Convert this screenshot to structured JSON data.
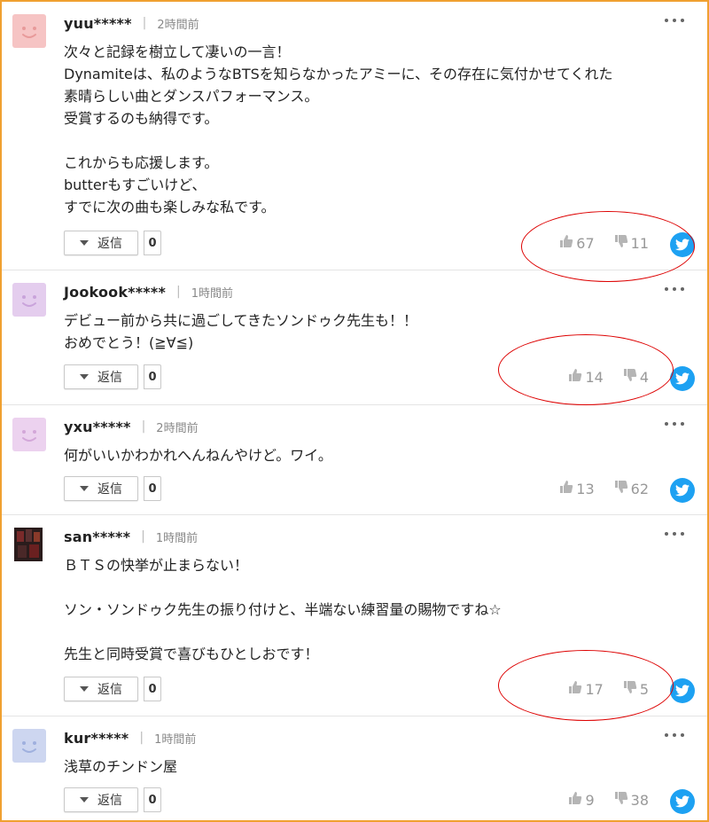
{
  "reply_label": "返信",
  "colors": {
    "frame": "#f0a030",
    "annotation": "#d00000",
    "twitter": "#1da1f2"
  },
  "comments": [
    {
      "username": "yuu*****",
      "time": "2時間前",
      "avatar_color": "#f6c4c4",
      "avatar_face": "#e89a9a",
      "lines": [
        "次々と記録を樹立して凄いの一言！",
        "Dynamiteは、私のようなBTSを知らなかったアミーに、その存在に気付かせてくれた",
        "素晴らしい曲とダンスパフォーマンス。",
        "受賞するのも納得です。",
        "",
        "これからも応援します。",
        "butterもすごいけど、",
        "すでに次の曲も楽しみな私です。"
      ],
      "reply_count": "0",
      "likes": "67",
      "dislikes": "11"
    },
    {
      "username": "Jookook*****",
      "time": "1時間前",
      "avatar_color": "#e4cdee",
      "avatar_face": "#c9a3db",
      "lines": [
        "デビュー前から共に過ごしてきたソンドゥク先生も！！",
        "おめでとう！(≧∀≦)"
      ],
      "reply_count": "0",
      "likes": "14",
      "dislikes": "4"
    },
    {
      "username": "yxu*****",
      "time": "2時間前",
      "avatar_color": "#ecd2ef",
      "avatar_face": "#d3a7d9",
      "lines": [
        "何がいいかわかれへんねんやけど。ワイ。"
      ],
      "reply_count": "0",
      "likes": "13",
      "dislikes": "62"
    },
    {
      "username": "san*****",
      "time": "1時間前",
      "avatar_color": "#3a2a2a",
      "avatar_face": "#8a2020",
      "lines": [
        "ＢＴＳの快挙が止まらない！",
        "",
        "ソン・ソンドゥク先生の振り付けと、半端ない練習量の賜物ですね☆",
        "",
        "先生と同時受賞で喜びもひとしおです！"
      ],
      "reply_count": "0",
      "likes": "17",
      "dislikes": "5"
    },
    {
      "username": "kur*****",
      "time": "1時間前",
      "avatar_color": "#cdd6f0",
      "avatar_face": "#9fb0de",
      "lines": [
        "浅草のチンドン屋"
      ],
      "reply_count": "0",
      "likes": "9",
      "dislikes": "38"
    }
  ]
}
